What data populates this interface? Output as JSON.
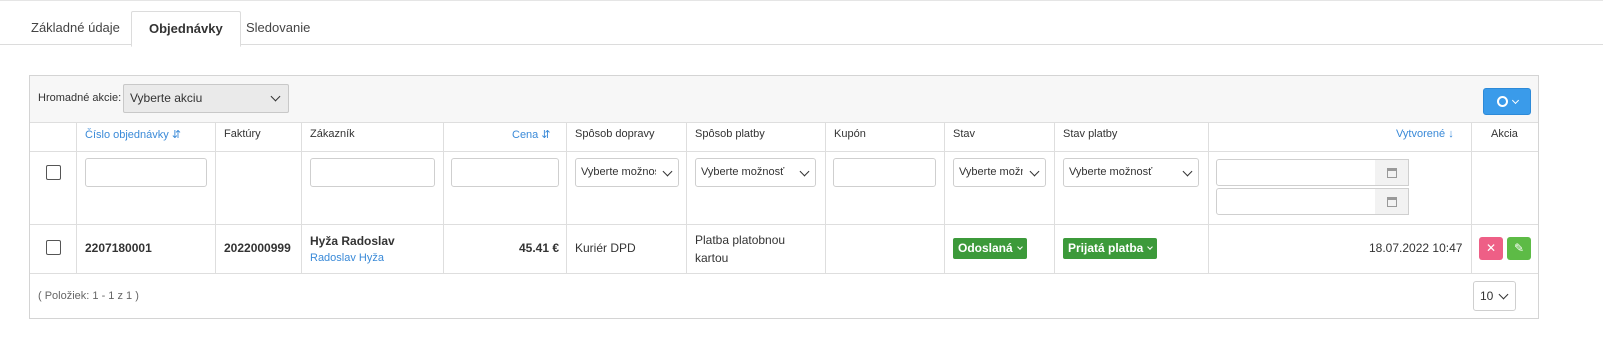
{
  "tabs": [
    {
      "label": "Základné údaje"
    },
    {
      "label": "Objednávky",
      "active": true
    },
    {
      "label": "Sledovanie"
    }
  ],
  "toolbar": {
    "bulk_label": "Hromadné akcie:",
    "bulk_select_value": "Vyberte akciu",
    "settings_icon": "gear-icon",
    "accent": "#3a9bea"
  },
  "columns": [
    {
      "label": "Číslo objednávky",
      "sort": "⇵"
    },
    {
      "label": "Faktúry"
    },
    {
      "label": "Zákazník"
    },
    {
      "label": "Cena",
      "sort": "⇵"
    },
    {
      "label": "Spôsob dopravy"
    },
    {
      "label": "Spôsob platby"
    },
    {
      "label": "Kupón"
    },
    {
      "label": "Stav"
    },
    {
      "label": "Stav platby"
    },
    {
      "label": "Vytvorené",
      "sort": "↓"
    },
    {
      "label": "Akcia"
    }
  ],
  "filters": {
    "doprava_placeholder": "Vyberte možnosť",
    "platba_placeholder": "Vyberte možnosť",
    "stav_placeholder": "Vyberte možnosť",
    "stav_platby_placeholder": "Vyberte možnosť"
  },
  "rows": [
    {
      "order_number": "2207180001",
      "invoice": "2022000999",
      "customer_name": "Hyža Radoslav",
      "customer_link": "Radoslav Hyža",
      "price": "45.41 €",
      "delivery": "Kuriér DPD",
      "payment_line1": "Platba platobnou",
      "payment_line2": "kartou",
      "coupon": "",
      "status": "Odoslaná",
      "payment_status": "Prijatá platba",
      "created": "18.07.2022 10:47"
    }
  ],
  "status_color": "#3c9a3a",
  "footer": {
    "count_text": "( Položiek: 1 - 1 z 1 )",
    "page_size": "10"
  }
}
